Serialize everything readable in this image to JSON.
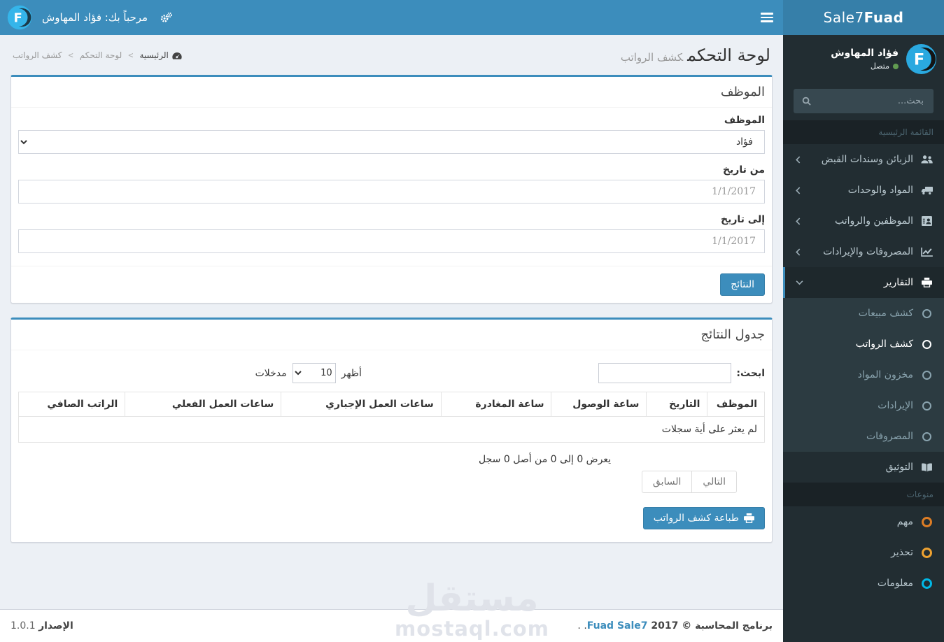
{
  "brand": {
    "bold": "Fuad",
    "rest": "Sale7"
  },
  "navbar": {
    "welcome": "مرحباً بك: فؤاد المهاوش"
  },
  "sidebar": {
    "user": {
      "name": "فؤاد المهاوش",
      "status": "متصل"
    },
    "search_placeholder": "بحث...",
    "section_main": "القائمة الرئيسية",
    "items": [
      {
        "label": "الزبائن وسندات القبض",
        "icon": "users-icon"
      },
      {
        "label": "المواد والوحدات",
        "icon": "truck-icon"
      },
      {
        "label": "الموظفين والرواتب",
        "icon": "id-card-icon"
      },
      {
        "label": "المصروفات والإيرادات",
        "icon": "line-chart-icon"
      },
      {
        "label": "التقارير",
        "icon": "printer-icon",
        "active": true,
        "expanded": true
      }
    ],
    "reports_children": [
      "كشف مبيعات",
      "كشف الرواتب",
      "مخزون المواد",
      "الإيرادات",
      "المصروفات"
    ],
    "active_child": "كشف الرواتب",
    "docs_item": {
      "label": "التوثيق",
      "icon": "book-icon"
    },
    "section_misc": "منوعات",
    "misc": [
      {
        "label": "مهم",
        "color": "#dd7d25"
      },
      {
        "label": "تحذير",
        "color": "#efa231"
      },
      {
        "label": "معلومات",
        "color": "#00b8e6"
      }
    ]
  },
  "content_header": {
    "title": "لوحة التحكم",
    "subtitle": "كشف الرواتب",
    "breadcrumb": [
      "الرئيسية",
      "لوحة التحكم",
      "كشف الرواتب"
    ],
    "separator": ">"
  },
  "filter_box": {
    "title": "الموظف",
    "employee_label": "الموظف",
    "employee_value": "فؤاد",
    "from_label": "من تاريخ",
    "from_placeholder": "1/1/2017",
    "to_label": "إلى تاريخ",
    "to_placeholder": "1/1/2017",
    "submit_label": "النتائج"
  },
  "results_box": {
    "title": "جدول النتائج",
    "search_label": "ابحث:",
    "length_before": "أظهر",
    "length_value": "10",
    "length_after": "مدخلات",
    "columns": [
      "الموظف",
      "التاريخ",
      "ساعة الوصول",
      "ساعة المغادرة",
      "ساعات العمل الإجباري",
      "ساعات العمل الفعلي",
      "الراتب الصافي"
    ],
    "empty_message": "لم يعثر على أية سجلات",
    "info": "يعرض 0 إلى 0 من أصل 0 سجل",
    "next_label": "التالي",
    "prev_label": "السابق",
    "print_label": "طباعة كشف الرواتب"
  },
  "footer": {
    "copy_prefix": "برنامج المحاسبة © 2017",
    "brand_link": "Fuad Sale7",
    "copy_suffix": ". .",
    "version_label": "الإصدار",
    "version_value": "1.0.1"
  },
  "watermark": {
    "ar": "مستقل",
    "en": "mostaql.com"
  },
  "colors": {
    "accent": "#3c8dbc",
    "brand_bg": "#367fa9",
    "sidebar_bg": "#222d32",
    "content_bg": "#ecf0f5"
  }
}
